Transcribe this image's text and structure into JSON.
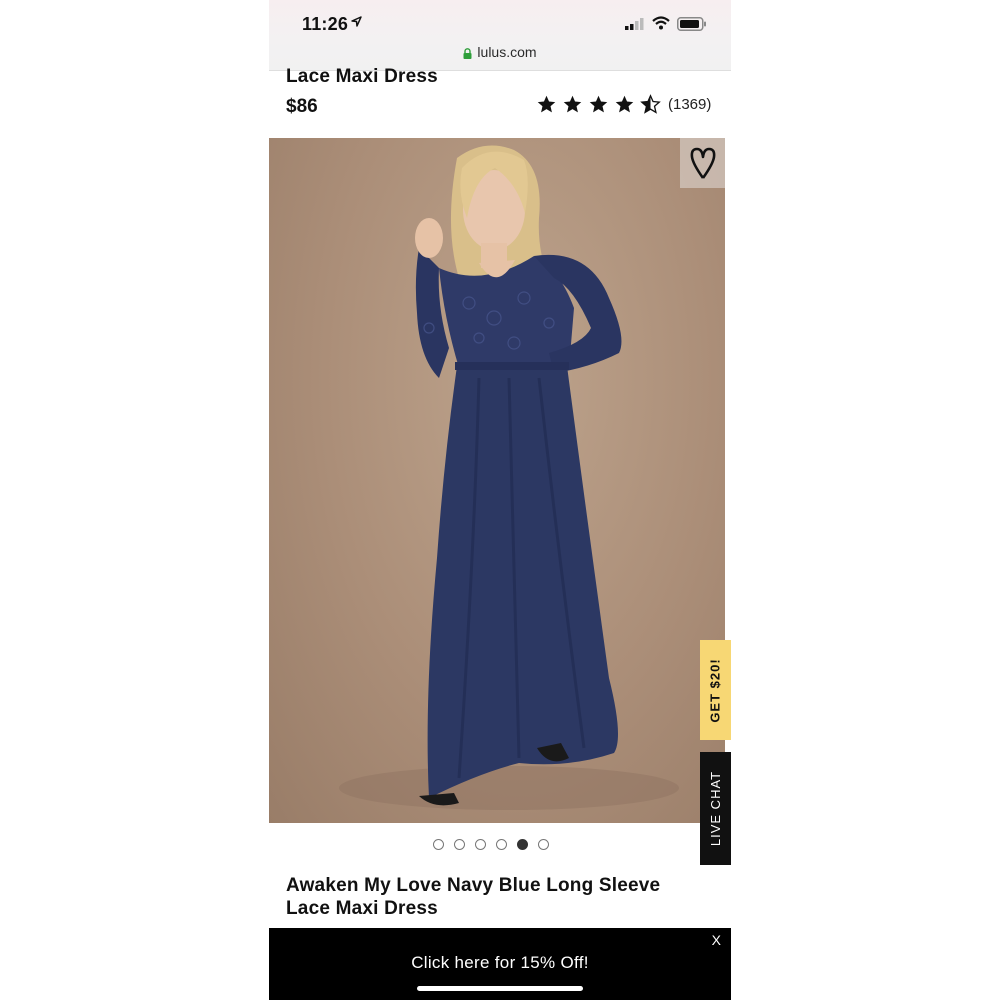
{
  "status_bar": {
    "time": "11:26",
    "url": "lulus.com",
    "icons": [
      "location-arrow-icon",
      "signal-icon",
      "wifi-icon",
      "battery-icon",
      "lock-icon"
    ]
  },
  "product": {
    "title_partial": "Lace Maxi Dress",
    "price": "$86",
    "rating": {
      "value": 4.5,
      "max": 5,
      "count": "(1369)"
    },
    "title": "Awaken My Love Navy Blue Long Sleeve Lace Maxi Dress"
  },
  "image": {
    "wishlist_icon": "heart-icon",
    "carousel": {
      "total": 6,
      "active_index": 4
    }
  },
  "side_tabs": {
    "promo_label": "GET $20!",
    "chat_label": "LIVE CHAT"
  },
  "banner": {
    "text": "Click here for 15% Off!",
    "close_label": "X"
  },
  "colors": {
    "background_photo": "#ab8e78",
    "dress": "#2c3863",
    "promo_tab": "#f7d774",
    "banner": "#000000"
  }
}
